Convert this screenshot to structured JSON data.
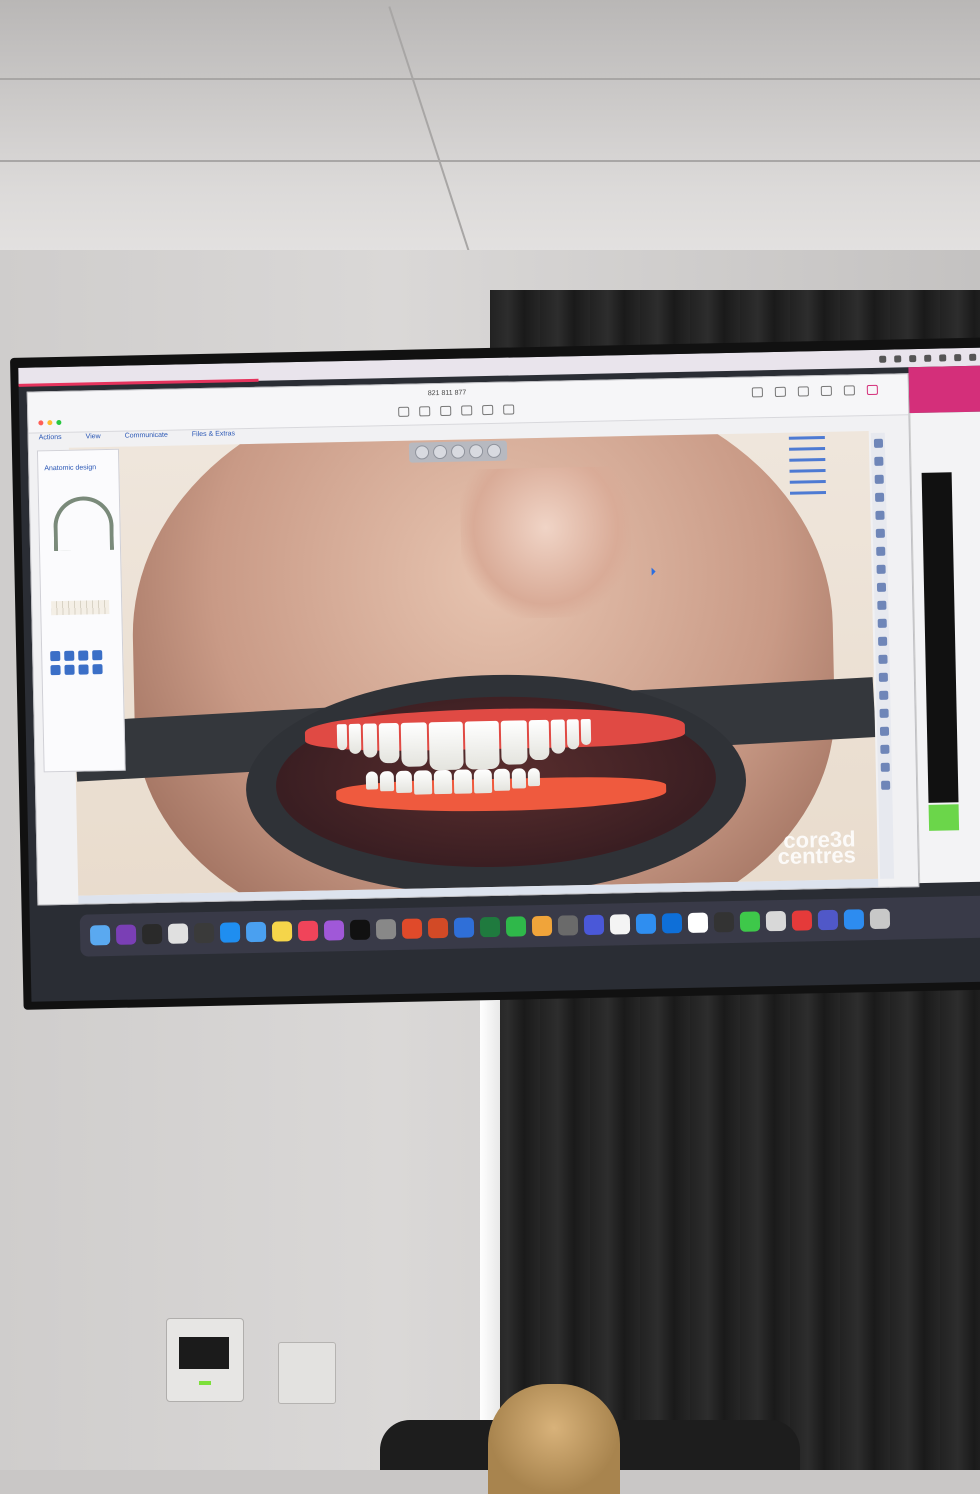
{
  "remote_window": {
    "title": "821 811 877",
    "menu": [
      "Actions",
      "View",
      "Communicate",
      "Files & Extras"
    ]
  },
  "left_panel": {
    "title": "Anatomic design"
  },
  "watermark": {
    "line1": "core3d",
    "line2": "centres"
  },
  "dock_apps": [
    "finder-icon",
    "onenote-icon",
    "siri-icon",
    "launchpad-icon",
    "calculator-icon",
    "appstore-icon",
    "mail-icon",
    "notes-icon",
    "music-icon",
    "podcasts-icon",
    "appletv-icon",
    "settings-icon",
    "tomato-icon",
    "powerpoint-icon",
    "keynote-icon",
    "excel-icon",
    "facetime-icon",
    "photos-icon",
    "imovie-icon",
    "stars-icon",
    "chrome-icon",
    "safari-icon",
    "teamviewer-icon",
    "dots-icon",
    "display-icon",
    "green-icon",
    "window-icon",
    "anydesk-icon",
    "teams-icon",
    "zoom-icon",
    "monitor-icon"
  ],
  "colors": {
    "accent_pink": "#d42f7a",
    "accent_blue": "#2a57b5",
    "gum_red": "#e04a44"
  }
}
